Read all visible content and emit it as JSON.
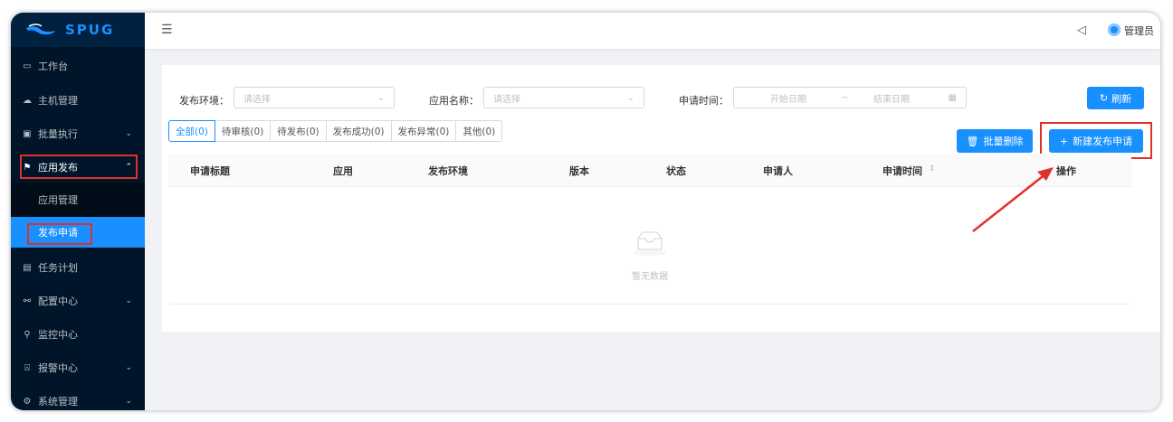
{
  "app": {
    "logo_text": "SPUG",
    "user_name": "管理员"
  },
  "sidebar": {
    "items": [
      {
        "label": "工作台",
        "icon": "desktop-icon"
      },
      {
        "label": "主机管理",
        "icon": "cloud-server-icon"
      },
      {
        "label": "批量执行",
        "icon": "code-icon",
        "has_arrow": true
      },
      {
        "label": "应用发布",
        "icon": "flag-icon",
        "has_arrow": true,
        "open": true
      },
      {
        "label": "任务计划",
        "icon": "schedule-icon"
      },
      {
        "label": "配置中心",
        "icon": "cluster-icon",
        "has_arrow": true
      },
      {
        "label": "监控中心",
        "icon": "monitor-icon"
      },
      {
        "label": "报警中心",
        "icon": "alert-icon",
        "has_arrow": true
      },
      {
        "label": "系统管理",
        "icon": "setting-icon",
        "has_arrow": true
      }
    ],
    "submenu": [
      {
        "label": "应用管理"
      },
      {
        "label": "发布申请",
        "active": true
      }
    ]
  },
  "filters": {
    "env_label": "发布环境：",
    "env_placeholder": "请选择",
    "app_label": "应用名称：",
    "app_placeholder": "请选择",
    "time_label": "申请时间：",
    "start_placeholder": "开始日期",
    "end_placeholder": "结束日期",
    "range_sep": "~",
    "refresh_label": "刷新"
  },
  "tabs": [
    {
      "label": "全部(0)",
      "active": true
    },
    {
      "label": "待审核(0)"
    },
    {
      "label": "待发布(0)"
    },
    {
      "label": "发布成功(0)"
    },
    {
      "label": "发布异常(0)"
    },
    {
      "label": "其他(0)"
    }
  ],
  "actions": {
    "batch_delete": "批量删除",
    "new_request": "新建发布申请"
  },
  "table": {
    "columns": [
      "申请标题",
      "应用",
      "发布环境",
      "版本",
      "状态",
      "申请人",
      "申请时间",
      "操作"
    ],
    "empty_text": "暂无数据"
  },
  "colors": {
    "primary": "#1890ff",
    "sidebar_bg": "#001529",
    "annotation_red": "#e0302b"
  }
}
